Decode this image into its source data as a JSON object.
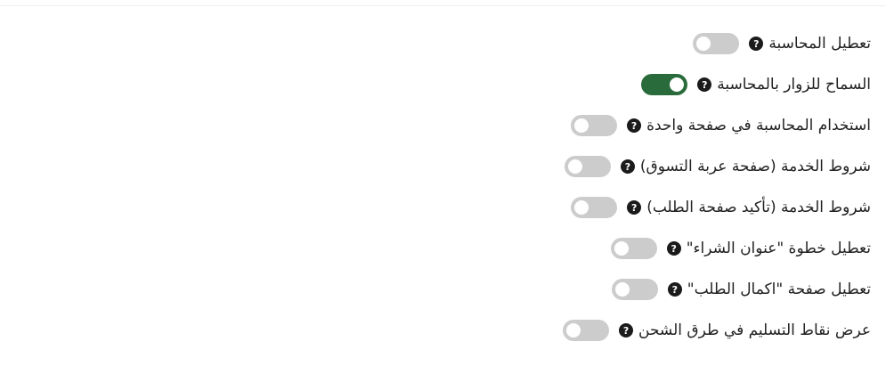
{
  "colors": {
    "toggle_on": "#2a6b3c",
    "toggle_off": "#cccccc",
    "help_icon": "#1b1b1b",
    "text": "#222222"
  },
  "settings": [
    {
      "label": "تعطيل المحاسبة",
      "help_icon": "question-circle-icon",
      "enabled": false
    },
    {
      "label": "السماح للزوار بالمحاسبة",
      "help_icon": "question-circle-icon",
      "enabled": true
    },
    {
      "label": "استخدام المحاسبة في صفحة واحدة",
      "help_icon": "question-circle-icon",
      "enabled": false
    },
    {
      "label": "شروط الخدمة (صفحة عربة التسوق)",
      "help_icon": "question-circle-icon",
      "enabled": false
    },
    {
      "label": "شروط الخدمة (تأكيد صفحة الطلب)",
      "help_icon": "question-circle-icon",
      "enabled": false
    },
    {
      "label": "تعطيل خطوة \"عنوان الشراء\"",
      "help_icon": "question-circle-icon",
      "enabled": false
    },
    {
      "label": "تعطيل صفحة \"اكمال الطلب\"",
      "help_icon": "question-circle-icon",
      "enabled": false
    },
    {
      "label": "عرض نقاط التسليم في طرق الشحن",
      "help_icon": "question-circle-icon",
      "enabled": false
    }
  ]
}
